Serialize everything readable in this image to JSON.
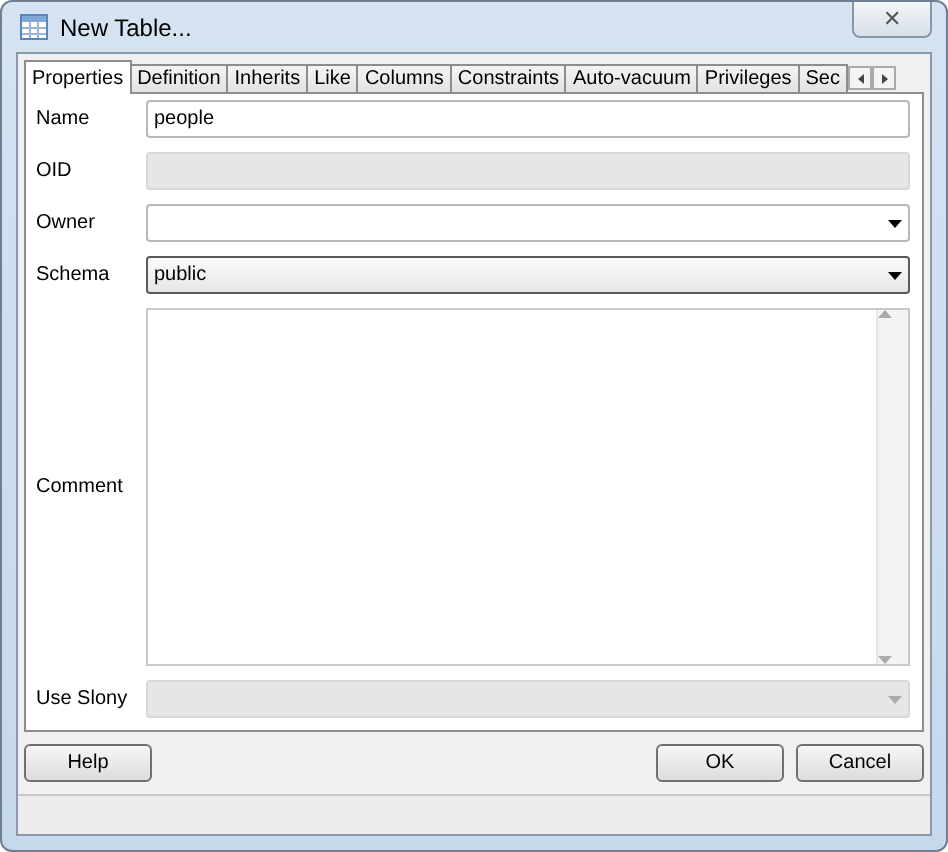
{
  "window": {
    "title": "New Table...",
    "close": "✕"
  },
  "tabs": [
    {
      "label": "Properties",
      "selected": true
    },
    {
      "label": "Definition",
      "selected": false
    },
    {
      "label": "Inherits",
      "selected": false
    },
    {
      "label": "Like",
      "selected": false
    },
    {
      "label": "Columns",
      "selected": false
    },
    {
      "label": "Constraints",
      "selected": false
    },
    {
      "label": "Auto-vacuum",
      "selected": false
    },
    {
      "label": "Privileges",
      "selected": false
    },
    {
      "label": "Sec",
      "selected": false
    }
  ],
  "fields": [
    {
      "label": "Name",
      "kind": "text",
      "value": "people",
      "disabled": false,
      "focused": false
    },
    {
      "label": "OID",
      "kind": "text",
      "disabled": true,
      "focused": false
    },
    {
      "label": "Owner",
      "kind": "combo",
      "disabled": false,
      "focused": false
    },
    {
      "label": "Schema",
      "kind": "combo",
      "value": "public",
      "disabled": false,
      "focused": true
    },
    {
      "label": "Comment",
      "kind": "textarea",
      "disabled": false,
      "focused": false
    },
    {
      "label": "Use Slony",
      "kind": "combo",
      "disabled": true,
      "focused": false
    }
  ],
  "buttons_left": [
    "Help"
  ],
  "buttons_right": [
    "OK",
    "Cancel"
  ]
}
